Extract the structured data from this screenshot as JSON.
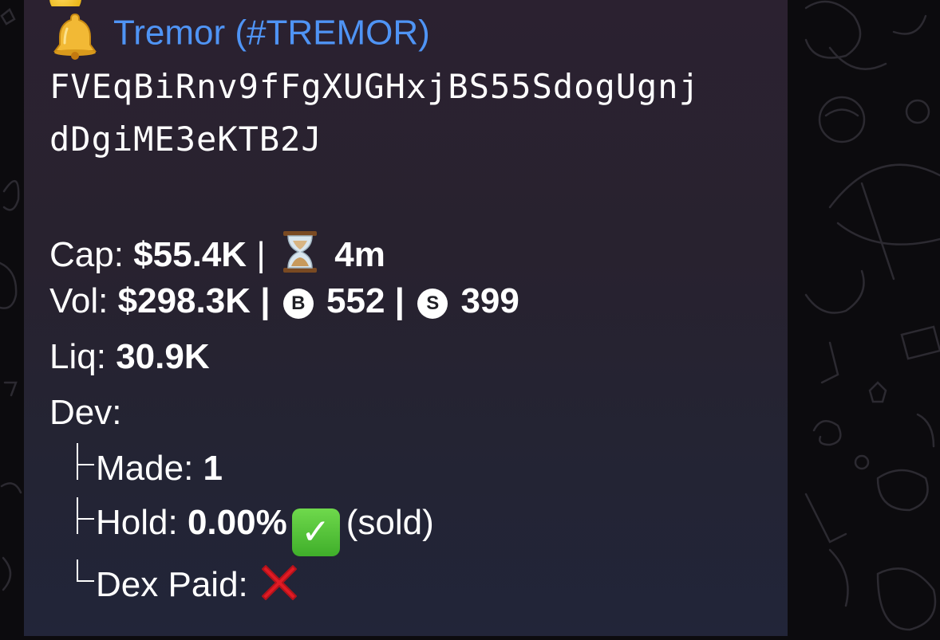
{
  "message": {
    "token_title": "Tremor (#TREMOR)",
    "contract_line1": "FVEqBiRnv9fFgXUGHxjBS55SdogUgnj",
    "contract_line2": "dDgiME3eKTB2J",
    "cap": {
      "label": "Cap:",
      "value": "$55.4K",
      "separator": "|",
      "age": "4m"
    },
    "vol": {
      "label": "Vol:",
      "value": "$298.3K",
      "separator1": "|",
      "buy_badge": "B",
      "buys": "552",
      "separator2": "|",
      "sell_badge": "S",
      "sells": "399"
    },
    "liq": {
      "label": "Liq:",
      "value": "30.9K"
    },
    "dev": {
      "label": "Dev:",
      "made_label": "Made:",
      "made_value": "1",
      "hold_label": "Hold:",
      "hold_value": "0.00%",
      "hold_note": "(sold)",
      "dex_paid_label": "Dex Paid:"
    }
  },
  "colors": {
    "link": "#4f94f5",
    "text": "#ffffff",
    "bubble": "#28222f"
  },
  "icons": {
    "title": "bell-icon",
    "age": "hourglass-icon",
    "hold_status": "check-mark-icon",
    "dex_paid_status": "cross-mark-icon"
  }
}
